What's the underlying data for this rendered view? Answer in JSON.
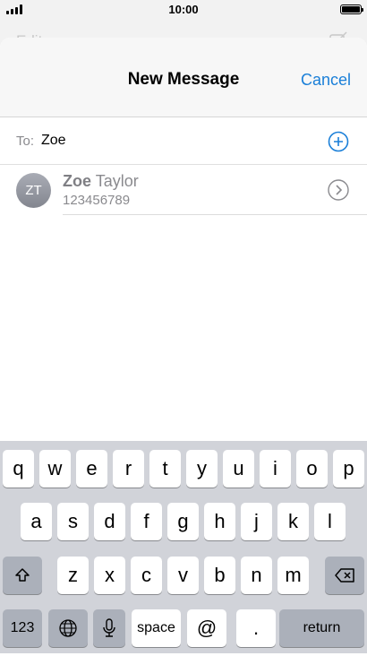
{
  "status_bar": {
    "time": "10:00"
  },
  "background_screen": {
    "edit_label": "Edit"
  },
  "compose": {
    "title": "New Message",
    "cancel_label": "Cancel",
    "to_label": "To:",
    "to_value": "Zoe",
    "suggestion": {
      "initials": "ZT",
      "first_name_match": "Zoe",
      "last_name": " Taylor",
      "phone": "123456789"
    }
  },
  "keyboard": {
    "row1": [
      "q",
      "w",
      "e",
      "r",
      "t",
      "y",
      "u",
      "i",
      "o",
      "p"
    ],
    "row2": [
      "a",
      "s",
      "d",
      "f",
      "g",
      "h",
      "j",
      "k",
      "l"
    ],
    "row3": [
      "z",
      "x",
      "c",
      "v",
      "b",
      "n",
      "m"
    ],
    "numbers_label": "123",
    "space_label": "space",
    "at_label": "@",
    "period_label": ".",
    "return_label": "return"
  },
  "colors": {
    "accent": "#1a7fd8",
    "keyboard_bg": "#d1d3d9",
    "dark_key": "#abb0ba"
  },
  "icons": [
    "signal-icon",
    "battery-icon",
    "compose-icon",
    "add-contact-icon",
    "chevron-right-icon",
    "shift-icon",
    "backspace-icon",
    "globe-icon",
    "microphone-icon"
  ]
}
